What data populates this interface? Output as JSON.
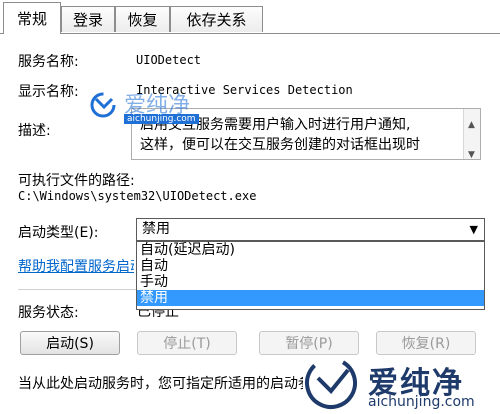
{
  "tabs": [
    "常规",
    "登录",
    "恢复",
    "依存关系"
  ],
  "general": {
    "service_name_label": "服务名称:",
    "service_name": "UIODetect",
    "display_name_label": "显示名称:",
    "display_name": "Interactive Services Detection",
    "description_label": "描述:",
    "description_line1": "启用交互服务需要用户输入时进行用户通知,",
    "description_line2": "这样，便可以在交互服务创建的对话框出现时",
    "exe_path_label": "可执行文件的路径:",
    "exe_path": "C:\\Windows\\system32\\UIODetect.exe",
    "startup_type_label": "启动类型(E):",
    "startup_type_value": "禁用",
    "startup_options": [
      "自动(延迟启动)",
      "自动",
      "手动",
      "禁用"
    ],
    "help_link": "帮助我配置服务启动选项。",
    "status_label": "服务状态:",
    "status_value": "已停止",
    "buttons": {
      "start": "启动(S)",
      "stop": "停止(T)",
      "pause": "暂停(P)",
      "resume": "恢复(R)"
    },
    "footer_text": "当从此处启动服务时，您可指定所适用的启动参数。"
  },
  "watermark": {
    "text": "爱纯净",
    "url": "aichunjing.com",
    "overlay_text": "aichunjing.com"
  },
  "colors": {
    "selection": "#3399ff",
    "link": "#0066cc",
    "watermark": "#1e6fd6"
  }
}
